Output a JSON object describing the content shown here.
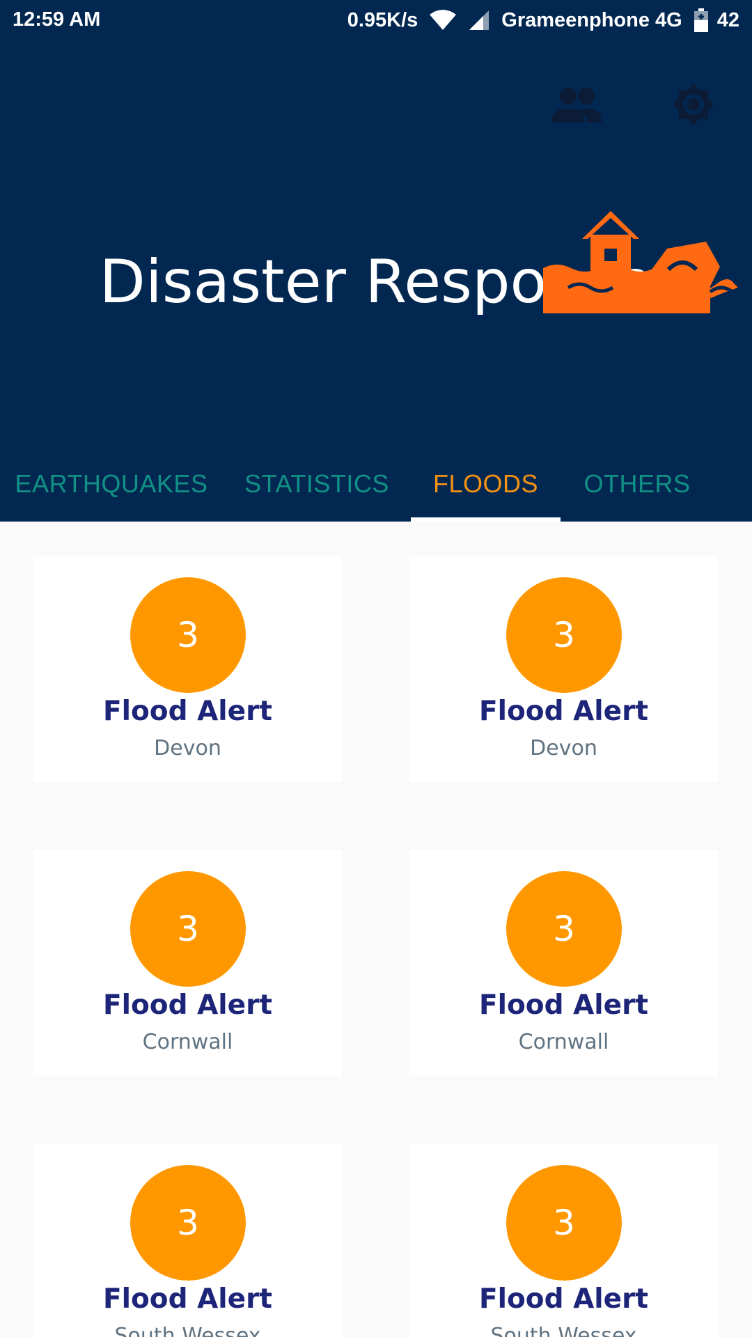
{
  "status_bar": {
    "time": "12:59 AM",
    "network_speed": "0.95K/s",
    "carrier": "Grameenphone 4G",
    "battery": "42"
  },
  "toolbar": {
    "icons": [
      "people-icon",
      "settings-icon"
    ]
  },
  "header": {
    "title": "Disaster Response"
  },
  "tabs": [
    {
      "label": "EARTHQUAKES",
      "active": false
    },
    {
      "label": "STATISTICS",
      "active": false
    },
    {
      "label": "FLOODS",
      "active": true
    },
    {
      "label": "OTHERS",
      "active": false
    }
  ],
  "colors": {
    "header_bg": "#022851",
    "tab_inactive": "#119186",
    "tab_active": "#f39213",
    "badge": "#ff9800",
    "card_title": "#1d2579",
    "card_subtitle": "#5f7281"
  },
  "alerts": [
    {
      "count": "3",
      "title": "Flood Alert",
      "location": "Devon"
    },
    {
      "count": "3",
      "title": "Flood Alert",
      "location": "Devon"
    },
    {
      "count": "3",
      "title": "Flood Alert",
      "location": "Cornwall"
    },
    {
      "count": "3",
      "title": "Flood Alert",
      "location": "Cornwall"
    },
    {
      "count": "3",
      "title": "Flood Alert",
      "location": "South Wessex"
    },
    {
      "count": "3",
      "title": "Flood Alert",
      "location": "South Wessex"
    }
  ]
}
